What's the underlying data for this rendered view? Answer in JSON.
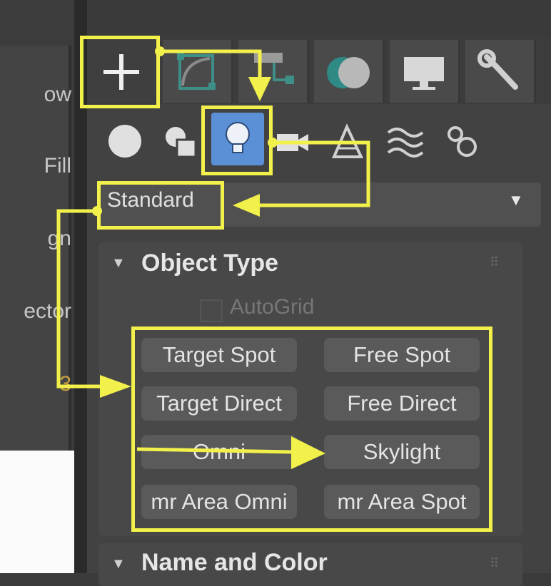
{
  "left_panel": {
    "items": [
      "ow",
      "Fill",
      "gn",
      "ector",
      "3"
    ]
  },
  "command_panel": {
    "tabs": [
      "create-icon",
      "modify-icon",
      "hierarchy-icon",
      "motion-icon",
      "display-icon",
      "utilities-icon"
    ],
    "categories": [
      "geometry-icon",
      "shapes-icon",
      "lights-icon",
      "cameras-icon",
      "helpers-icon",
      "space-warps-icon",
      "systems-icon"
    ],
    "dropdown": {
      "value": "Standard"
    },
    "object_type": {
      "title": "Object Type",
      "autogrid_label": "AutoGrid",
      "buttons": [
        "Target Spot",
        "Free Spot",
        "Target Direct",
        "Free Direct",
        "Omni",
        "Skylight",
        "mr Area Omni",
        "mr Area Spot"
      ]
    },
    "name_and_color": {
      "title": "Name and Color"
    }
  },
  "annotation_color": "#f2f04a",
  "panel_bg": "#424242",
  "active_tab_color": "#5b8fd6"
}
